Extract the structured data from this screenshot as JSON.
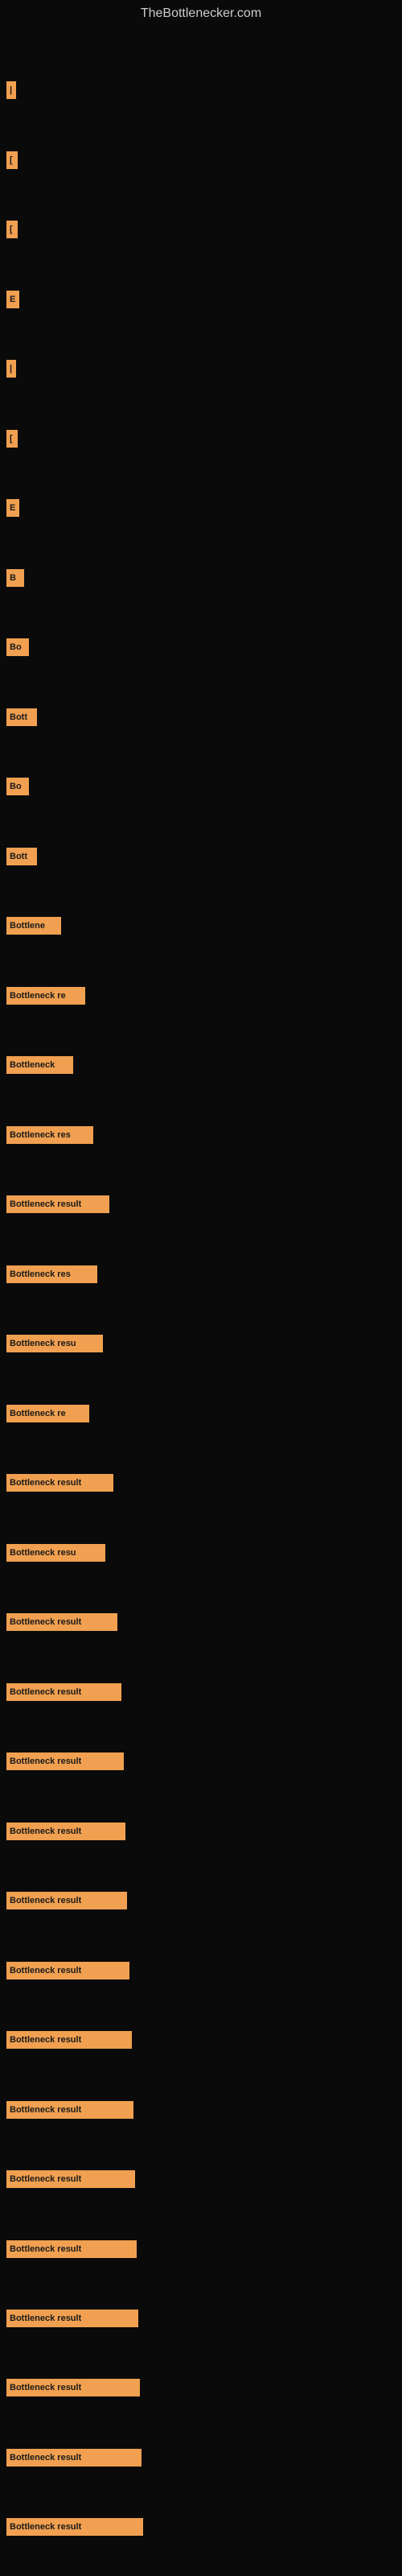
{
  "site": {
    "title": "TheBottlenecker.com"
  },
  "bars": [
    {
      "id": 1,
      "label": "|",
      "width": 4,
      "top_gap": 60
    },
    {
      "id": 2,
      "label": "[",
      "width": 6,
      "top_gap": 30
    },
    {
      "id": 3,
      "label": "[",
      "width": 6,
      "top_gap": 30
    },
    {
      "id": 4,
      "label": "E",
      "width": 8,
      "top_gap": 30
    },
    {
      "id": 5,
      "label": "|",
      "width": 4,
      "top_gap": 30
    },
    {
      "id": 6,
      "label": "[",
      "width": 6,
      "top_gap": 30
    },
    {
      "id": 7,
      "label": "E",
      "width": 8,
      "top_gap": 30
    },
    {
      "id": 8,
      "label": "B",
      "width": 14,
      "top_gap": 30
    },
    {
      "id": 9,
      "label": "Bo",
      "width": 20,
      "top_gap": 30
    },
    {
      "id": 10,
      "label": "Bott",
      "width": 30,
      "top_gap": 30
    },
    {
      "id": 11,
      "label": "Bo",
      "width": 20,
      "top_gap": 30
    },
    {
      "id": 12,
      "label": "Bott",
      "width": 30,
      "top_gap": 30
    },
    {
      "id": 13,
      "label": "Bottlene",
      "width": 60,
      "top_gap": 30
    },
    {
      "id": 14,
      "label": "Bottleneck re",
      "width": 90,
      "top_gap": 30
    },
    {
      "id": 15,
      "label": "Bottleneck",
      "width": 75,
      "top_gap": 30
    },
    {
      "id": 16,
      "label": "Bottleneck res",
      "width": 100,
      "top_gap": 30
    },
    {
      "id": 17,
      "label": "Bottleneck result",
      "width": 120,
      "top_gap": 30
    },
    {
      "id": 18,
      "label": "Bottleneck res",
      "width": 105,
      "top_gap": 30
    },
    {
      "id": 19,
      "label": "Bottleneck resu",
      "width": 112,
      "top_gap": 30
    },
    {
      "id": 20,
      "label": "Bottleneck re",
      "width": 95,
      "top_gap": 30
    },
    {
      "id": 21,
      "label": "Bottleneck result",
      "width": 125,
      "top_gap": 30
    },
    {
      "id": 22,
      "label": "Bottleneck resu",
      "width": 115,
      "top_gap": 30
    },
    {
      "id": 23,
      "label": "Bottleneck result",
      "width": 130,
      "top_gap": 30
    },
    {
      "id": 24,
      "label": "Bottleneck result",
      "width": 135,
      "top_gap": 30
    },
    {
      "id": 25,
      "label": "Bottleneck result",
      "width": 138,
      "top_gap": 30
    },
    {
      "id": 26,
      "label": "Bottleneck result",
      "width": 140,
      "top_gap": 30
    },
    {
      "id": 27,
      "label": "Bottleneck result",
      "width": 142,
      "top_gap": 30
    },
    {
      "id": 28,
      "label": "Bottleneck result",
      "width": 145,
      "top_gap": 30
    },
    {
      "id": 29,
      "label": "Bottleneck result",
      "width": 148,
      "top_gap": 30
    },
    {
      "id": 30,
      "label": "Bottleneck result",
      "width": 150,
      "top_gap": 30
    },
    {
      "id": 31,
      "label": "Bottleneck result",
      "width": 152,
      "top_gap": 30
    },
    {
      "id": 32,
      "label": "Bottleneck result",
      "width": 154,
      "top_gap": 30
    },
    {
      "id": 33,
      "label": "Bottleneck result",
      "width": 156,
      "top_gap": 30
    },
    {
      "id": 34,
      "label": "Bottleneck result",
      "width": 158,
      "top_gap": 30
    },
    {
      "id": 35,
      "label": "Bottleneck result",
      "width": 160,
      "top_gap": 30
    },
    {
      "id": 36,
      "label": "Bottleneck result",
      "width": 162,
      "top_gap": 30
    }
  ]
}
